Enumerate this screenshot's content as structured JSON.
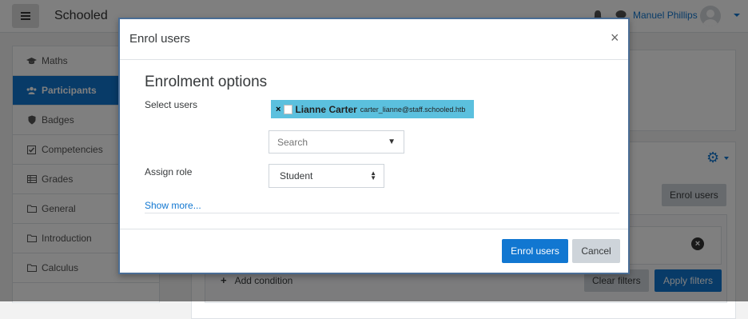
{
  "navbar": {
    "site_name": "Schooled",
    "user_name": "Manuel Phillips",
    "icons": [
      "menu-icon",
      "bell-icon",
      "chat-icon",
      "avatar",
      "chevron-down-icon"
    ]
  },
  "sidebar": {
    "items": [
      {
        "label": "Maths",
        "icon": "graduation-cap-icon",
        "active": false
      },
      {
        "label": "Participants",
        "icon": "users-icon",
        "active": true
      },
      {
        "label": "Badges",
        "icon": "shield-icon",
        "active": false
      },
      {
        "label": "Competencies",
        "icon": "checkbox-icon",
        "active": false
      },
      {
        "label": "Grades",
        "icon": "table-icon",
        "active": false
      },
      {
        "label": "General",
        "icon": "folder-icon",
        "active": false
      },
      {
        "label": "Introduction",
        "icon": "folder-icon",
        "active": false
      },
      {
        "label": "Calculus",
        "icon": "folder-icon",
        "active": false
      }
    ]
  },
  "main": {
    "enrol_users_label": "Enrol users",
    "add_condition_label": "Add condition",
    "clear_filters_label": "Clear filters",
    "apply_filters_label": "Apply filters"
  },
  "modal": {
    "title": "Enrol users",
    "close_symbol": "×",
    "section_title": "Enrolment options",
    "select_users_label": "Select users",
    "selected_user": {
      "name": "Lianne Carter",
      "email": "carter_lianne@staff.schooled.htb",
      "remove_symbol": "×"
    },
    "search_placeholder": "Search",
    "assign_role_label": "Assign role",
    "role_value": "Student",
    "show_more_label": "Show more...",
    "enrol_button_label": "Enrol users",
    "cancel_button_label": "Cancel"
  },
  "colors": {
    "primary": "#1177d1",
    "chip": "#5bc0de",
    "modal_border": "#4a6d95",
    "secondary_button": "#ced4da"
  }
}
